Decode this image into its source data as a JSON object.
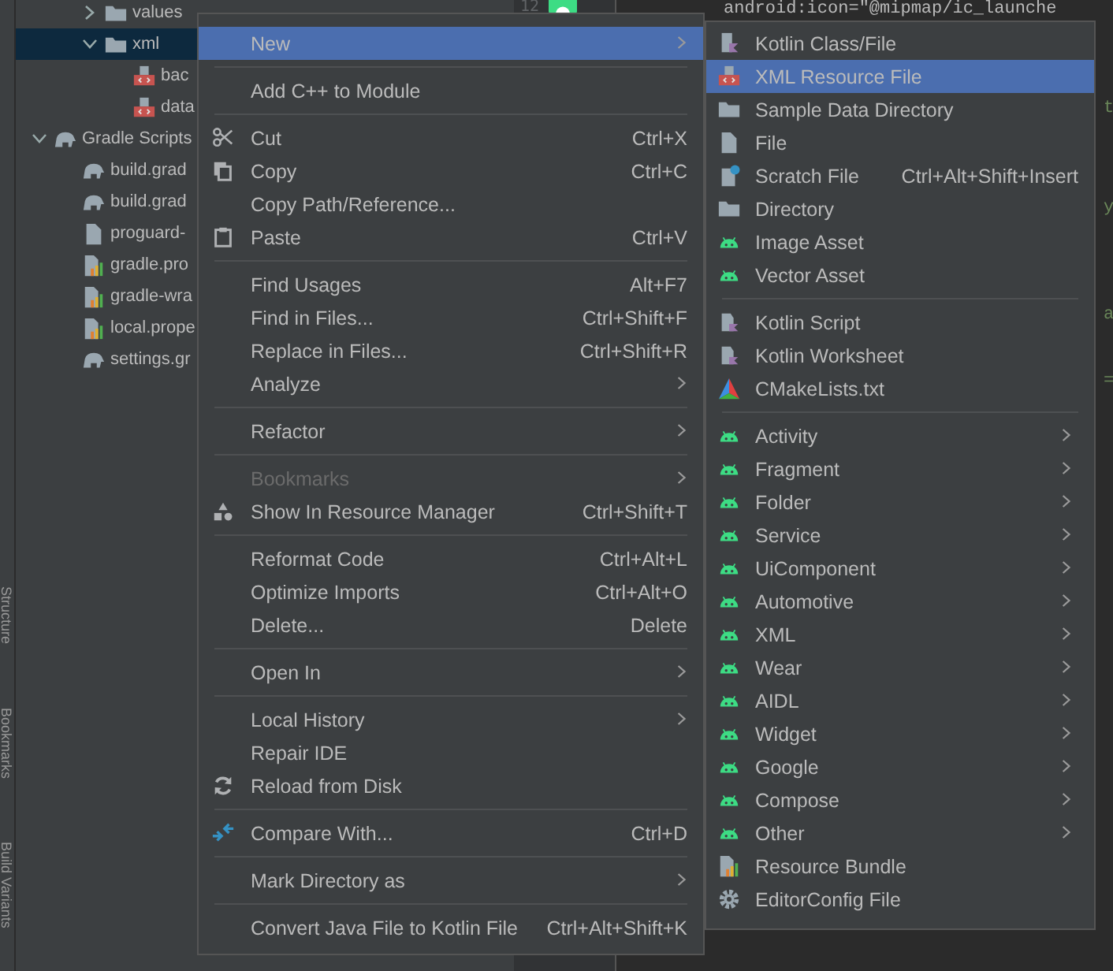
{
  "tool_strip": [
    {
      "label": "Structure"
    },
    {
      "label": "Bookmarks"
    },
    {
      "label": "Build Variants"
    }
  ],
  "tree": [
    {
      "label": "values",
      "kind": "folder",
      "expanded": false,
      "selected": false
    },
    {
      "label": "xml",
      "kind": "folder",
      "expanded": true,
      "selected": true,
      "children": [
        {
          "label": "bac",
          "kind": "xml-file",
          "selected": false
        },
        {
          "label": "data",
          "kind": "xml-file",
          "selected": false
        }
      ]
    },
    {
      "label": "Gradle Scripts",
      "kind": "gradle",
      "expanded": true,
      "selected": false,
      "children": [
        {
          "label": "build.grad",
          "kind": "gradle",
          "selected": false
        },
        {
          "label": "build.grad",
          "kind": "gradle",
          "selected": false
        },
        {
          "label": "proguard-",
          "kind": "file",
          "selected": false
        },
        {
          "label": "gradle.pro",
          "kind": "properties",
          "selected": false
        },
        {
          "label": "gradle-wra",
          "kind": "properties",
          "selected": false
        },
        {
          "label": "local.prope",
          "kind": "properties",
          "selected": false
        },
        {
          "label": "settings.gr",
          "kind": "gradle",
          "selected": false
        }
      ]
    }
  ],
  "gutter": {
    "line_number": "12"
  },
  "editor": {
    "lines": [
      {
        "text": "android:icon=\"@mipmap/ic_launche"
      },
      {
        "text": "t"
      },
      {
        "text": "y"
      },
      {
        "text": "a"
      },
      {
        "text": "="
      }
    ]
  },
  "context_menu": {
    "groups": [
      [
        {
          "label": "New",
          "submenu": true,
          "selected": true,
          "disabled": false
        }
      ],
      [
        {
          "label": "Add C++ to Module",
          "submenu": false,
          "selected": false,
          "disabled": false
        }
      ],
      [
        {
          "label": "Cut",
          "shortcut": "Ctrl+X",
          "submenu": false,
          "selected": false,
          "disabled": false
        },
        {
          "label": "Copy",
          "shortcut": "Ctrl+C",
          "submenu": false,
          "selected": false,
          "disabled": false
        },
        {
          "label": "Copy Path/Reference...",
          "submenu": false,
          "selected": false,
          "disabled": false
        },
        {
          "label": "Paste",
          "shortcut": "Ctrl+V",
          "submenu": false,
          "selected": false,
          "disabled": false
        }
      ],
      [
        {
          "label": "Find Usages",
          "shortcut": "Alt+F7",
          "submenu": false,
          "selected": false,
          "disabled": false
        },
        {
          "label": "Find in Files...",
          "shortcut": "Ctrl+Shift+F",
          "submenu": false,
          "selected": false,
          "disabled": false
        },
        {
          "label": "Replace in Files...",
          "shortcut": "Ctrl+Shift+R",
          "submenu": false,
          "selected": false,
          "disabled": false
        },
        {
          "label": "Analyze",
          "submenu": true,
          "selected": false,
          "disabled": false
        }
      ],
      [
        {
          "label": "Refactor",
          "submenu": true,
          "selected": false,
          "disabled": false
        }
      ],
      [
        {
          "label": "Bookmarks",
          "submenu": true,
          "selected": false,
          "disabled": true
        },
        {
          "label": "Show In Resource Manager",
          "shortcut": "Ctrl+Shift+T",
          "submenu": false,
          "selected": false,
          "disabled": false
        }
      ],
      [
        {
          "label": "Reformat Code",
          "shortcut": "Ctrl+Alt+L",
          "submenu": false,
          "selected": false,
          "disabled": false
        },
        {
          "label": "Optimize Imports",
          "shortcut": "Ctrl+Alt+O",
          "submenu": false,
          "selected": false,
          "disabled": false
        },
        {
          "label": "Delete...",
          "shortcut": "Delete",
          "submenu": false,
          "selected": false,
          "disabled": false
        }
      ],
      [
        {
          "label": "Open In",
          "submenu": true,
          "selected": false,
          "disabled": false
        }
      ],
      [
        {
          "label": "Local History",
          "submenu": true,
          "selected": false,
          "disabled": false
        },
        {
          "label": "Repair IDE",
          "submenu": false,
          "selected": false,
          "disabled": false
        },
        {
          "label": "Reload from Disk",
          "submenu": false,
          "selected": false,
          "disabled": false
        }
      ],
      [
        {
          "label": "Compare With...",
          "shortcut": "Ctrl+D",
          "submenu": false,
          "selected": false,
          "disabled": false
        }
      ],
      [
        {
          "label": "Mark Directory as",
          "submenu": true,
          "selected": false,
          "disabled": false
        }
      ],
      [
        {
          "label": "Convert Java File to Kotlin File",
          "shortcut": "Ctrl+Alt+Shift+K",
          "submenu": false,
          "selected": false,
          "disabled": false
        }
      ]
    ]
  },
  "new_submenu": {
    "groups": [
      [
        {
          "label": "Kotlin Class/File",
          "submenu": false,
          "selected": false
        },
        {
          "label": "XML Resource File",
          "submenu": false,
          "selected": true
        },
        {
          "label": "Sample Data Directory",
          "submenu": false,
          "selected": false
        },
        {
          "label": "File",
          "submenu": false,
          "selected": false
        },
        {
          "label": "Scratch File",
          "shortcut": "Ctrl+Alt+Shift+Insert",
          "submenu": false,
          "selected": false
        },
        {
          "label": "Directory",
          "submenu": false,
          "selected": false
        },
        {
          "label": "Image Asset",
          "submenu": false,
          "selected": false
        },
        {
          "label": "Vector Asset",
          "submenu": false,
          "selected": false
        }
      ],
      [
        {
          "label": "Kotlin Script",
          "submenu": false,
          "selected": false
        },
        {
          "label": "Kotlin Worksheet",
          "submenu": false,
          "selected": false
        },
        {
          "label": "CMakeLists.txt",
          "submenu": false,
          "selected": false
        }
      ],
      [
        {
          "label": "Activity",
          "submenu": true,
          "selected": false
        },
        {
          "label": "Fragment",
          "submenu": true,
          "selected": false
        },
        {
          "label": "Folder",
          "submenu": true,
          "selected": false
        },
        {
          "label": "Service",
          "submenu": true,
          "selected": false
        },
        {
          "label": "UiComponent",
          "submenu": true,
          "selected": false
        },
        {
          "label": "Automotive",
          "submenu": true,
          "selected": false
        },
        {
          "label": "XML",
          "submenu": true,
          "selected": false
        },
        {
          "label": "Wear",
          "submenu": true,
          "selected": false
        },
        {
          "label": "AIDL",
          "submenu": true,
          "selected": false
        },
        {
          "label": "Widget",
          "submenu": true,
          "selected": false
        },
        {
          "label": "Google",
          "submenu": true,
          "selected": false
        },
        {
          "label": "Compose",
          "submenu": true,
          "selected": false
        },
        {
          "label": "Other",
          "submenu": true,
          "selected": false
        },
        {
          "label": "Resource Bundle",
          "submenu": false,
          "selected": false
        },
        {
          "label": "EditorConfig File",
          "submenu": false,
          "selected": false
        }
      ]
    ]
  }
}
